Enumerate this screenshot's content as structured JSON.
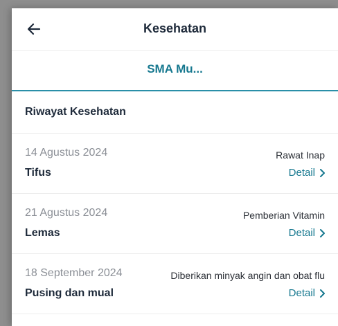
{
  "header": {
    "title": "Kesehatan",
    "back_icon": "arrow-left-icon"
  },
  "tab": {
    "label": "SMA Mu..."
  },
  "section": {
    "title": "Riwayat Kesehatan"
  },
  "records": [
    {
      "date": "14 Agustus 2024",
      "name": "Tifus",
      "action": "Rawat Inap",
      "detail_label": "Detail"
    },
    {
      "date": "21 Agustus 2024",
      "name": "Lemas",
      "action": "Pemberian Vitamin",
      "detail_label": "Detail"
    },
    {
      "date": "18 September 2024",
      "name": "Pusing dan mual",
      "action": "Diberikan minyak angin dan obat flu",
      "detail_label": "Detail"
    }
  ],
  "colors": {
    "accent": "#16788f",
    "tab_underline": "#2a8fa8",
    "title_text": "#1e2a3a",
    "muted_text": "#8b8f96"
  }
}
